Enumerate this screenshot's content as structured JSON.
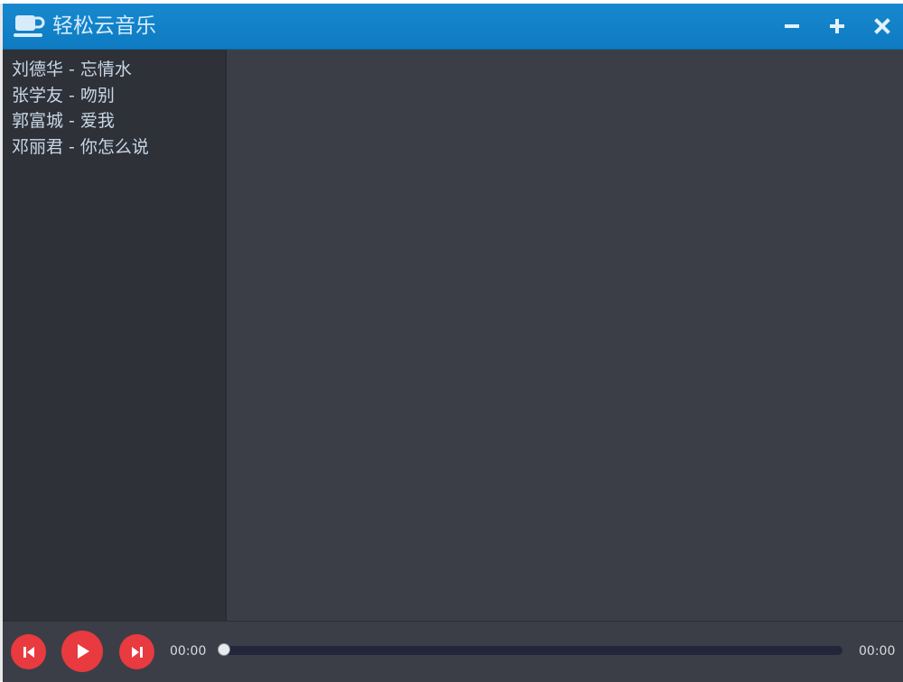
{
  "app": {
    "title": "轻松云音乐",
    "icon": "coffee-cup-icon",
    "accent_color": "#1788cf"
  },
  "window_controls": [
    {
      "name": "minimize",
      "icon": "minus-icon"
    },
    {
      "name": "maximize",
      "icon": "plus-icon"
    },
    {
      "name": "close",
      "icon": "close-icon"
    }
  ],
  "playlist": [
    "刘德华 - 忘情水",
    "张学友 - 吻别",
    "郭富城 - 爱我",
    "邓丽君 - 你怎么说"
  ],
  "player": {
    "prev_icon": "skip-previous-icon",
    "play_icon": "play-icon",
    "next_icon": "skip-next-icon",
    "button_color": "#e83a3f",
    "current_time": "00:00",
    "total_time": "00:00",
    "progress": 0
  }
}
